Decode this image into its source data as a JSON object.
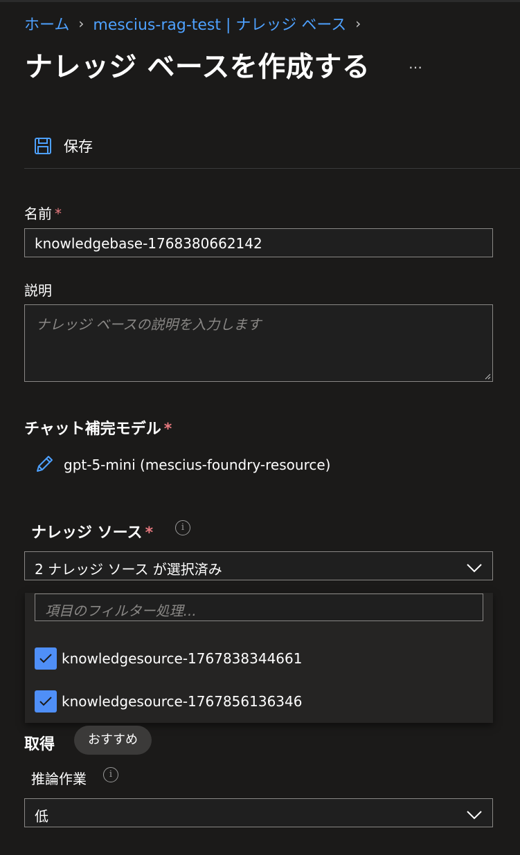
{
  "breadcrumb": {
    "items": [
      "ホーム",
      "mescius-rag-test | ナレッジ ベース"
    ]
  },
  "page": {
    "title": "ナレッジ ベースを作成する",
    "more_label": "…"
  },
  "toolbar": {
    "save_label": "保存"
  },
  "form": {
    "name": {
      "label": "名前",
      "required_mark": "*",
      "value": "knowledgebase-1768380662142"
    },
    "description": {
      "label": "説明",
      "placeholder": "ナレッジ ベースの説明を入力します"
    },
    "chat_model": {
      "label": "チャット補完モデル",
      "required_mark": "*",
      "value": "gpt-5-mini (mescius-foundry-resource)"
    },
    "knowledge_source": {
      "label": "ナレッジ ソース",
      "required_mark": "*",
      "info": "i",
      "selected_summary": "2 ナレッジ ソース が選択済み",
      "filter_placeholder": "項目のフィルター処理...",
      "options": [
        {
          "label": "knowledgesource-1767838344661",
          "checked": true
        },
        {
          "label": "knowledgesource-1767856136346",
          "checked": true
        }
      ]
    },
    "retrieval": {
      "label": "取得",
      "badge": "おすすめ"
    },
    "reasoning_effort": {
      "label": "推論作業",
      "info": "i",
      "value": "低"
    }
  },
  "colors": {
    "background": "#1b1a19",
    "accent": "#4ea1ff",
    "checkbox": "#4f8ff7",
    "required": "#e8797f",
    "border": "#8a8886"
  }
}
